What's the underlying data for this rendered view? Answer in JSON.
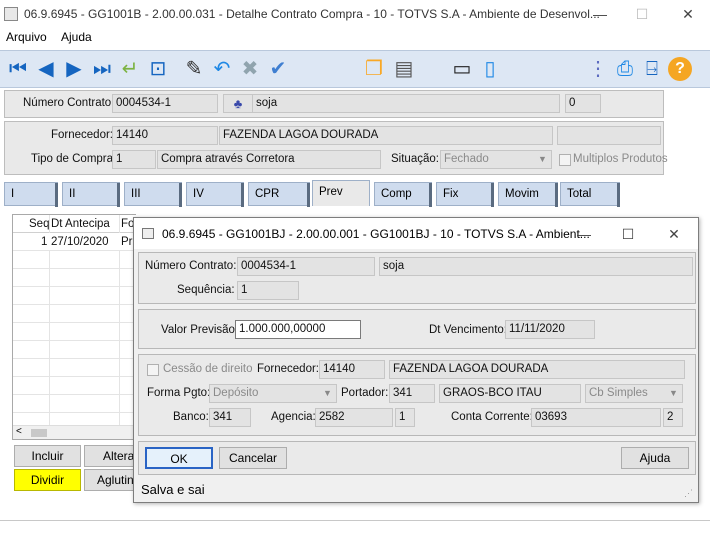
{
  "window": {
    "title": "06.9.6945 - GG1001B - 2.00.00.031 - Detalhe Contrato Compra - 10 - TOTVS S.A - Ambiente de Desenvol...",
    "minimize": "—",
    "maximize": "☐",
    "close": "✕"
  },
  "menu": {
    "items": [
      "Arquivo",
      "Ajuda"
    ]
  },
  "toolbar": {
    "icons": [
      "first-icon",
      "prev-icon",
      "next-icon",
      "last-icon",
      "goto-icon",
      "search-icon",
      "edit-icon",
      "undo-icon",
      "delete-icon",
      "save-icon",
      "copy-icon",
      "print-list-icon",
      "form-icon",
      "document-icon",
      "tree-icon",
      "printer-icon",
      "exit-icon",
      "help-icon"
    ]
  },
  "header": {
    "contract_label": "Número Contrato:",
    "contract_value": "0004534-1",
    "commodity": "soja",
    "extra": "0"
  },
  "supplier": {
    "label": "Fornecedor:",
    "code": "14140",
    "name": "FAZENDA LAGOA DOURADA",
    "type_label": "Tipo de Compra:",
    "type_code": "1",
    "type_desc": "Compra através Corretora",
    "situation_label": "Situação:",
    "situation_value": "Fechado",
    "multi_label": "Multiplos Produtos"
  },
  "tabs": [
    "I",
    "II",
    "III",
    "IV",
    "CPR",
    "Prev",
    "Comp",
    "Fix",
    "Movim",
    "Total"
  ],
  "grid": {
    "headers": [
      "Seq",
      "Dt Antecipa",
      "Fo"
    ],
    "row1": {
      "seq": "1",
      "date": "27/10/2020",
      "fo": "Pr"
    }
  },
  "buttons": {
    "incluir": "Incluir",
    "alterar": "Alterar",
    "dividir": "Dividir",
    "aglutinar": "Aglutinar"
  },
  "dialog": {
    "title": "06.9.6945 - GG1001BJ - 2.00.00.001 - GG1001BJ - 10 - TOTVS S.A - Ambient...",
    "contract_label": "Número Contrato:",
    "contract_value": "0004534-1",
    "commodity": "soja",
    "seq_label": "Sequência:",
    "seq_value": "1",
    "valor_label": "Valor Previsão:",
    "valor_value": "1.000.000,00000",
    "venc_label": "Dt Vencimento:",
    "venc_value": "11/11/2020",
    "cessao_label": "Cessão de direito",
    "forn_label": "Fornecedor:",
    "forn_code": "14140",
    "forn_name": "FAZENDA LAGOA DOURADA",
    "forma_label": "Forma Pgto:",
    "forma_value": "Depósito",
    "portador_label": "Portador:",
    "portador_code": "341",
    "portador_name": "GRAOS-BCO ITAU",
    "cb_value": "Cb Simples",
    "banco_label": "Banco:",
    "banco_value": "341",
    "agencia_label": "Agencia:",
    "agencia_value": "2582",
    "agencia_dv": "1",
    "conta_label": "Conta Corrente:",
    "conta_value": "03693",
    "conta_dv": "2",
    "ok": "OK",
    "cancelar": "Cancelar",
    "ajuda": "Ajuda",
    "status": "Salva e sai"
  }
}
